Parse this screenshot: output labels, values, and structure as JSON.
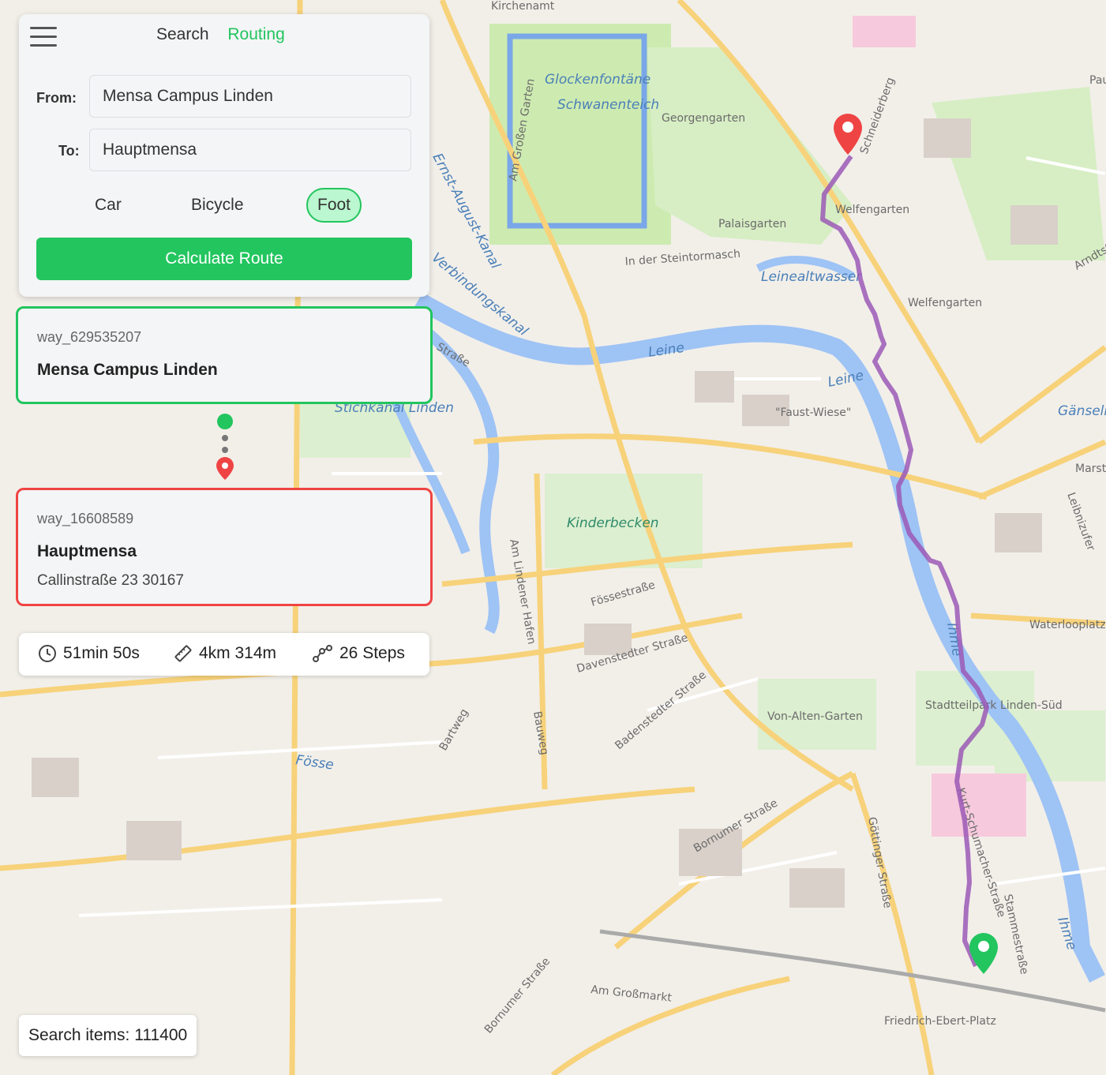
{
  "panel": {
    "tabs": [
      {
        "label": "Search",
        "active": false
      },
      {
        "label": "Routing",
        "active": true
      }
    ],
    "from_label": "From:",
    "from_value": "Mensa Campus Linden",
    "to_label": "To:",
    "to_value": "Hauptmensa",
    "modes": [
      {
        "label": "Car",
        "active": false
      },
      {
        "label": "Bicycle",
        "active": false
      },
      {
        "label": "Foot",
        "active": true
      }
    ],
    "calculate_label": "Calculate Route"
  },
  "start": {
    "id": "way_629535207",
    "name": "Mensa Campus Linden"
  },
  "end": {
    "id": "way_16608589",
    "name": "Hauptmensa",
    "address": "Callinstraße 23 30167"
  },
  "stats": {
    "duration": "51min 50s",
    "distance": "4km 314m",
    "steps": "26 Steps"
  },
  "search_count": "Search items: 111400",
  "map": {
    "labels": [
      "Kirchenamt",
      "Glockenfontäne",
      "Schwanenteich",
      "Georgengarten",
      "Am Großen Garten",
      "Schneiderberg",
      "Welfengarten",
      "Palaisgarten",
      "In der Steintormasch",
      "Leinealtwasser",
      "Welfengarten",
      "Ernst-August-Kanal",
      "Verbindungskanal",
      "Leine",
      "Leine",
      "Straße",
      "\"Faust-Wiese\"",
      "Gänseliese",
      "Stichkanal Linden",
      "Marstall",
      "Kinderbecken",
      "Am Lindener Hafen",
      "Fössestraße",
      "Leibnizufer",
      "Waterlooplatz",
      "Davenstedter Straße",
      "Badenstedter Straße",
      "Ihme",
      "Von-Alten-Garten",
      "Stadtteilpark Linden-Süd",
      "Bartweg",
      "Bauweg",
      "Fösse",
      "Bornumer Straße",
      "Göttinger Straße",
      "Kurt-Schumacher-Straße",
      "Stammestraße",
      "Ihme",
      "Am Großmarkt",
      "Bornumer Straße",
      "Friedrich-Ebert-Platz",
      "Arndtstraße",
      "Pauluskirche"
    ],
    "route_color": "#9b59b6",
    "origin_marker_color": "#ef4444",
    "destination_marker_color": "#22c55e"
  }
}
